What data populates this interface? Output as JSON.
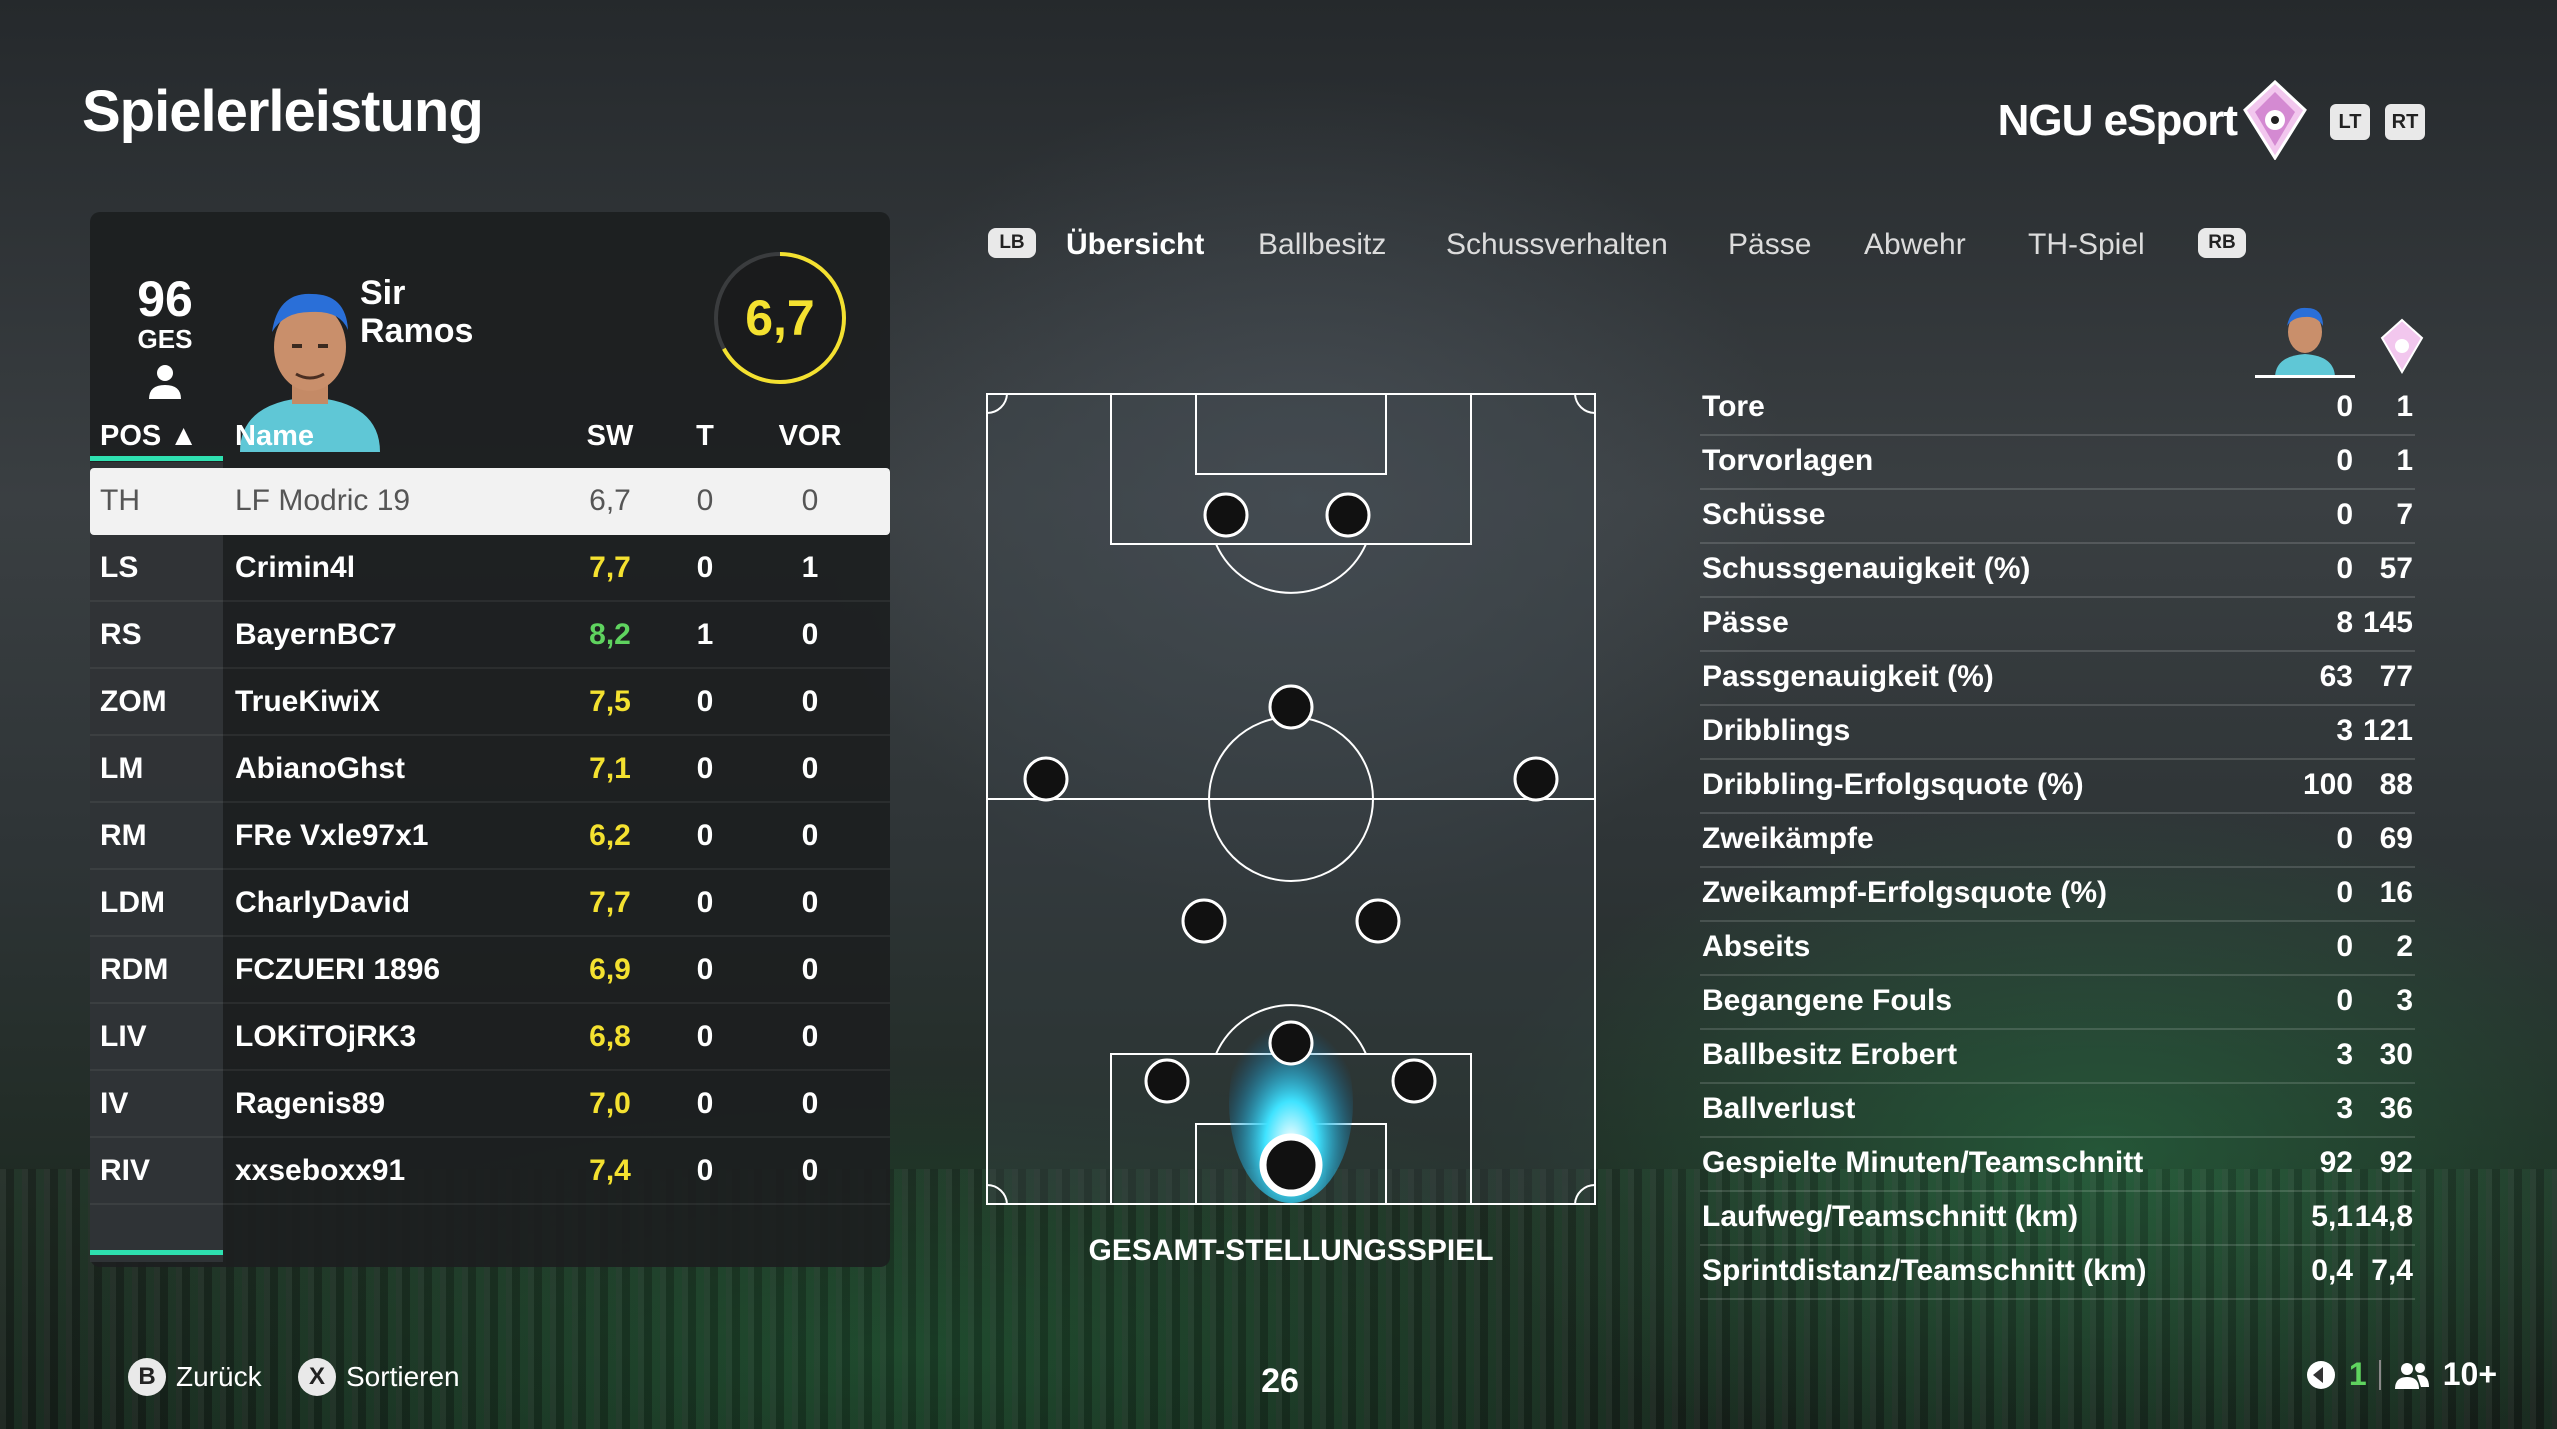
{
  "header": {
    "title": "Spielerleistung",
    "team": "NGU eSport",
    "trigger_left": "LT",
    "trigger_right": "RT"
  },
  "player": {
    "overall": "96",
    "overall_label": "GES",
    "first_name": "Sir",
    "last_name": "Ramos",
    "rating": "6,7",
    "rating_fraction": 0.67
  },
  "table": {
    "headers": {
      "pos": "POS ▲",
      "name": "Name",
      "sw": "SW",
      "t": "T",
      "vor": "VOR"
    },
    "rows": [
      {
        "pos": "TH",
        "name": "LF Modric 19",
        "sw": "6,7",
        "t": "0",
        "vor": "0",
        "selected": true
      },
      {
        "pos": "LS",
        "name": "Crimin4l",
        "sw": "7,7",
        "t": "0",
        "vor": "1"
      },
      {
        "pos": "RS",
        "name": "BayernBC7",
        "sw": "8,2",
        "t": "1",
        "vor": "0"
      },
      {
        "pos": "ZOM",
        "name": "TrueKiwiX",
        "sw": "7,5",
        "t": "0",
        "vor": "0"
      },
      {
        "pos": "LM",
        "name": "AbianoGhst",
        "sw": "7,1",
        "t": "0",
        "vor": "0"
      },
      {
        "pos": "RM",
        "name": "FRe Vxle97x1",
        "sw": "6,2",
        "t": "0",
        "vor": "0"
      },
      {
        "pos": "LDM",
        "name": "CharlyDavid",
        "sw": "7,7",
        "t": "0",
        "vor": "0"
      },
      {
        "pos": "RDM",
        "name": "FCZUERI 1896",
        "sw": "6,9",
        "t": "0",
        "vor": "0"
      },
      {
        "pos": "LIV",
        "name": "LOKiTOjRK3",
        "sw": "6,8",
        "t": "0",
        "vor": "0"
      },
      {
        "pos": "IV",
        "name": "Ragenis89",
        "sw": "7,0",
        "t": "0",
        "vor": "0"
      },
      {
        "pos": "RIV",
        "name": "xxseboxx91",
        "sw": "7,4",
        "t": "0",
        "vor": "0"
      }
    ]
  },
  "tabs": {
    "bumper_left": "LB",
    "bumper_right": "RB",
    "items": [
      "Übersicht",
      "Ballbesitz",
      "Schussverhalten",
      "Pässe",
      "Abwehr",
      "TH-Spiel"
    ],
    "active": "Übersicht"
  },
  "pitch": {
    "label": "GESAMT-STELLUNGSSPIEL"
  },
  "stats": [
    {
      "label": "Tore",
      "player": "0",
      "team": "1"
    },
    {
      "label": "Torvorlagen",
      "player": "0",
      "team": "1"
    },
    {
      "label": "Schüsse",
      "player": "0",
      "team": "7"
    },
    {
      "label": "Schussgenauigkeit (%)",
      "player": "0",
      "team": "57"
    },
    {
      "label": "Pässe",
      "player": "8",
      "team": "145"
    },
    {
      "label": "Passgenauigkeit (%)",
      "player": "63",
      "team": "77"
    },
    {
      "label": "Dribblings",
      "player": "3",
      "team": "121"
    },
    {
      "label": "Dribbling-Erfolgsquote (%)",
      "player": "100",
      "team": "88"
    },
    {
      "label": "Zweikämpfe",
      "player": "0",
      "team": "69"
    },
    {
      "label": "Zweikampf-Erfolgsquote (%)",
      "player": "0",
      "team": "16"
    },
    {
      "label": "Abseits",
      "player": "0",
      "team": "2"
    },
    {
      "label": "Begangene Fouls",
      "player": "0",
      "team": "3"
    },
    {
      "label": "Ballbesitz Erobert",
      "player": "3",
      "team": "30"
    },
    {
      "label": "Ballverlust",
      "player": "3",
      "team": "36"
    },
    {
      "label": "Gespielte Minuten/Teamschnitt",
      "player": "92",
      "team": "92"
    },
    {
      "label": "Laufweg/Teamschnitt (km)",
      "player": "5,1",
      "team": "14,8"
    },
    {
      "label": "Sprintdistanz/Teamschnitt (km)",
      "player": "0,4",
      "team": "7,4"
    }
  ],
  "footer": {
    "back_key": "B",
    "back_label": "Zurück",
    "sort_key": "X",
    "sort_label": "Sortieren",
    "timer": "26",
    "count_a": "1",
    "count_b": "10+"
  },
  "colors": {
    "rating_yellow": "#f4e130",
    "rating_green": "#5fd35f",
    "accent": "#2ee0b0"
  }
}
